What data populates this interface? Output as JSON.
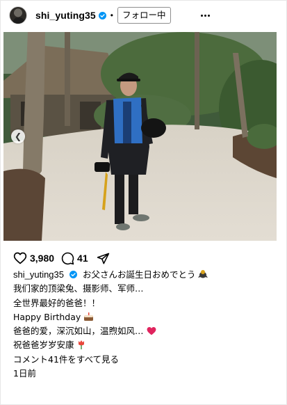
{
  "header": {
    "username": "shi_yuting35",
    "separator": "•",
    "follow_label": "フォロー中"
  },
  "actions": {
    "like_count": "3,980",
    "comment_count": "41"
  },
  "caption": {
    "username": "shi_yuting35",
    "line1": "お父さんお誕生日おめでとう",
    "line2": "我们家的顶梁兔、摄影师、军师…",
    "line3": "全世界最好的爸爸！！",
    "line4": "Happy Birthday",
    "line5": "爸爸的爱，深沉如山，温煦如风…",
    "line6": "祝爸爸岁岁安康",
    "view_comments": "コメント41件をすべて見る",
    "timestamp": "1日前"
  },
  "colors": {
    "verified": "#0095f6",
    "heart_emoji": "#e0245e"
  },
  "icons": [
    "verified-badge-icon",
    "more-options-icon",
    "heart-icon",
    "comment-icon",
    "share-icon",
    "chevron-left-icon",
    "cake-icon",
    "bird-emoji-icon",
    "red-heart-icon",
    "tulip-icon"
  ]
}
